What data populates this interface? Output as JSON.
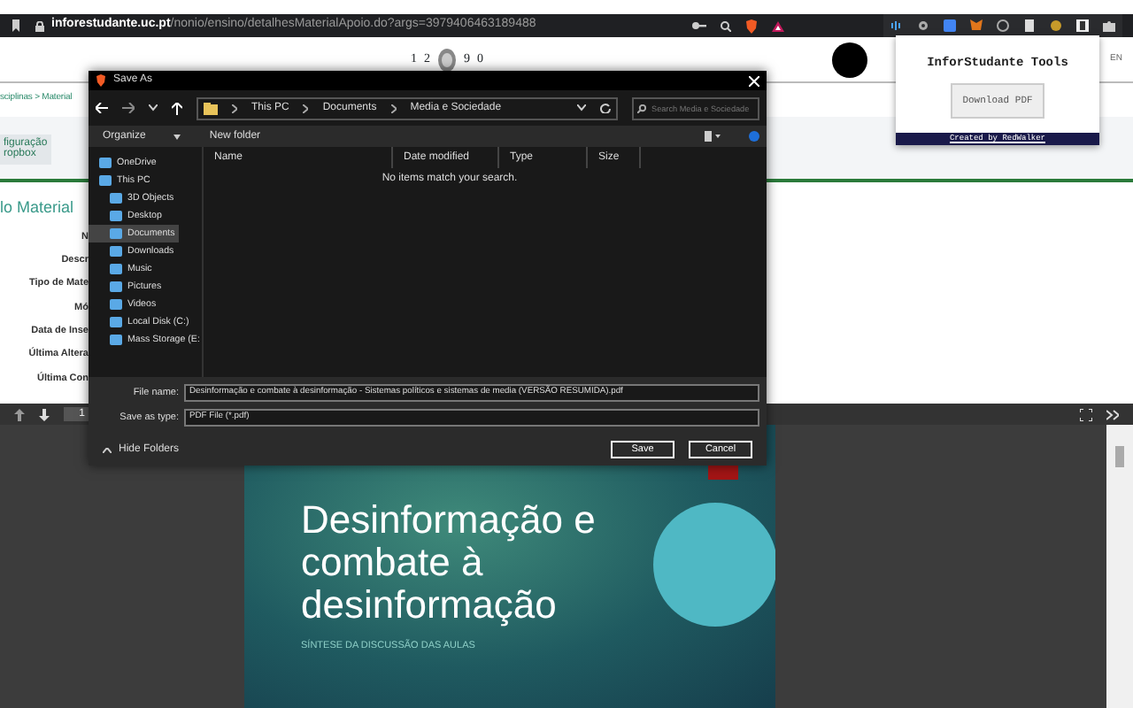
{
  "browser": {
    "url_host": "inforestudante.uc.pt",
    "url_path": "/nonio/ensino/detalhesMaterialApoio.do?args=3979406463189488"
  },
  "page": {
    "pager": [
      "1",
      "2",
      "9",
      "0"
    ],
    "language": "EN",
    "breadcrumb": "sciplinas > Material",
    "tab_lines": [
      "figuração",
      "ropbox"
    ],
    "heading": "lo Material",
    "labels": [
      "N",
      "Descr",
      "Tipo de Mate",
      "Mó",
      "Data de Inse",
      "Última Altera",
      "Última Con"
    ]
  },
  "pdf_toolbar": {
    "page": "1"
  },
  "slide": {
    "title": "Desinformação e combate à desinformação",
    "subtitle": "SÍNTESE DA DISCUSSÃO DAS AULAS"
  },
  "dialog": {
    "title": "Save As",
    "path": [
      "This PC",
      "Documents",
      "Media e Sociedade"
    ],
    "search": {
      "placeholder": "Search Media e Sociedade"
    },
    "toolbar": [
      "Organize",
      "New folder"
    ],
    "nav": [
      {
        "label": "OneDrive",
        "selected": false
      },
      {
        "label": "This PC",
        "selected": false,
        "children": [
          {
            "label": "3D Objects",
            "selected": false
          },
          {
            "label": "Desktop",
            "selected": false
          },
          {
            "label": "Documents",
            "selected": true
          },
          {
            "label": "Downloads",
            "selected": false
          },
          {
            "label": "Music",
            "selected": false
          },
          {
            "label": "Pictures",
            "selected": false
          },
          {
            "label": "Videos",
            "selected": false
          },
          {
            "label": "Local Disk (C:)",
            "selected": false
          },
          {
            "label": "Mass Storage (E:",
            "selected": false
          }
        ]
      }
    ],
    "columns": [
      "Name",
      "Date modified",
      "Type",
      "Size"
    ],
    "empty_message": "No items match your search.",
    "fields": [
      {
        "label": "File name:",
        "value": "Desinformação e combate à desinformação - Sistemas políticos e sistemas de media (VERSÃO RESUMIDA).pdf"
      },
      {
        "label": "Save as type:",
        "value": "PDF File (*.pdf)"
      }
    ],
    "hide_folders": "Hide Folders",
    "buttons": [
      "Save",
      "Cancel"
    ]
  },
  "extension_popup": {
    "title": "InforStudante Tools",
    "button": "Download PDF",
    "footer": "Created by RedWalker"
  }
}
